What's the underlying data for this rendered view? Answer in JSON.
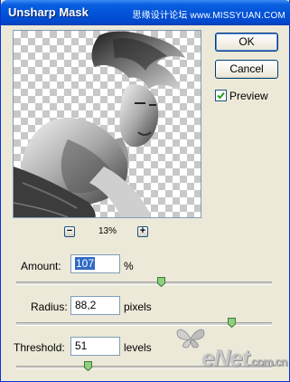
{
  "window": {
    "title": "Unsharp Mask"
  },
  "watermark_top": "思缘设计论坛 www.MISSYUAN.COM",
  "buttons": {
    "ok": "OK",
    "cancel": "Cancel"
  },
  "preview": {
    "label": "Preview",
    "checked": true
  },
  "zoom": {
    "level": "13%",
    "minus": "−",
    "plus": "+"
  },
  "amount": {
    "label": "Amount:",
    "value": "107",
    "unit": "%",
    "slider_fraction": 0.55
  },
  "radius": {
    "label": "Radius:",
    "value": "88,2",
    "unit": "pixels",
    "slider_fraction": 0.84
  },
  "threshold": {
    "label": "Threshold:",
    "value": "51",
    "unit": "levels",
    "slider_fraction": 0.26
  },
  "watermark_bottom": {
    "main": "eNet",
    "suffix": ".com.cn"
  },
  "colors": {
    "title_bar": "#0254d9",
    "dialog_bg": "#ece9d8",
    "selection": "#316ac5",
    "thumb": "#6bb35e"
  }
}
